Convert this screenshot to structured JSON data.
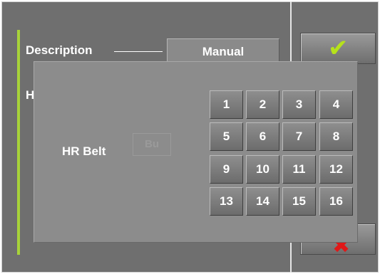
{
  "main": {
    "description_label": "Description",
    "tab_manual_label": "Manual",
    "partial_label": "H",
    "ok_icon": "checkmark-icon",
    "cancel_icon": "close-icon"
  },
  "popup": {
    "hr_label": "HR Belt",
    "hr_field_value": "Bu",
    "keys": [
      "1",
      "2",
      "3",
      "4",
      "5",
      "6",
      "7",
      "8",
      "9",
      "10",
      "11",
      "12",
      "13",
      "14",
      "15",
      "16"
    ]
  },
  "colors": {
    "accent": "#a8d33a",
    "check": "#b6e21a",
    "cancel": "#e01818"
  }
}
